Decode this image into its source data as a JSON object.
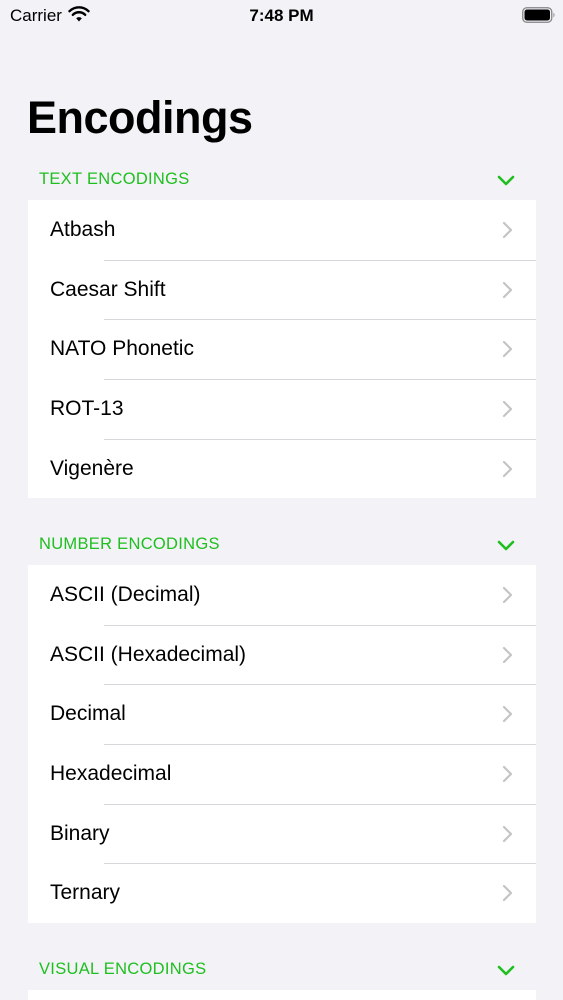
{
  "status_bar": {
    "carrier": "Carrier",
    "time": "7:48 PM",
    "icons": [
      "wifi-icon",
      "battery-icon"
    ]
  },
  "page": {
    "title": "Encodings"
  },
  "accent_color": "#1fbf1f",
  "sections": [
    {
      "title": "TEXT ENCODINGS",
      "expanded": true,
      "items": [
        "Atbash",
        "Caesar Shift",
        "NATO Phonetic",
        "ROT-13",
        "Vigenère"
      ]
    },
    {
      "title": "NUMBER ENCODINGS",
      "expanded": true,
      "items": [
        "ASCII (Decimal)",
        "ASCII (Hexadecimal)",
        "Decimal",
        "Hexadecimal",
        "Binary",
        "Ternary"
      ]
    },
    {
      "title": "VISUAL ENCODINGS",
      "expanded": true,
      "items": []
    }
  ]
}
